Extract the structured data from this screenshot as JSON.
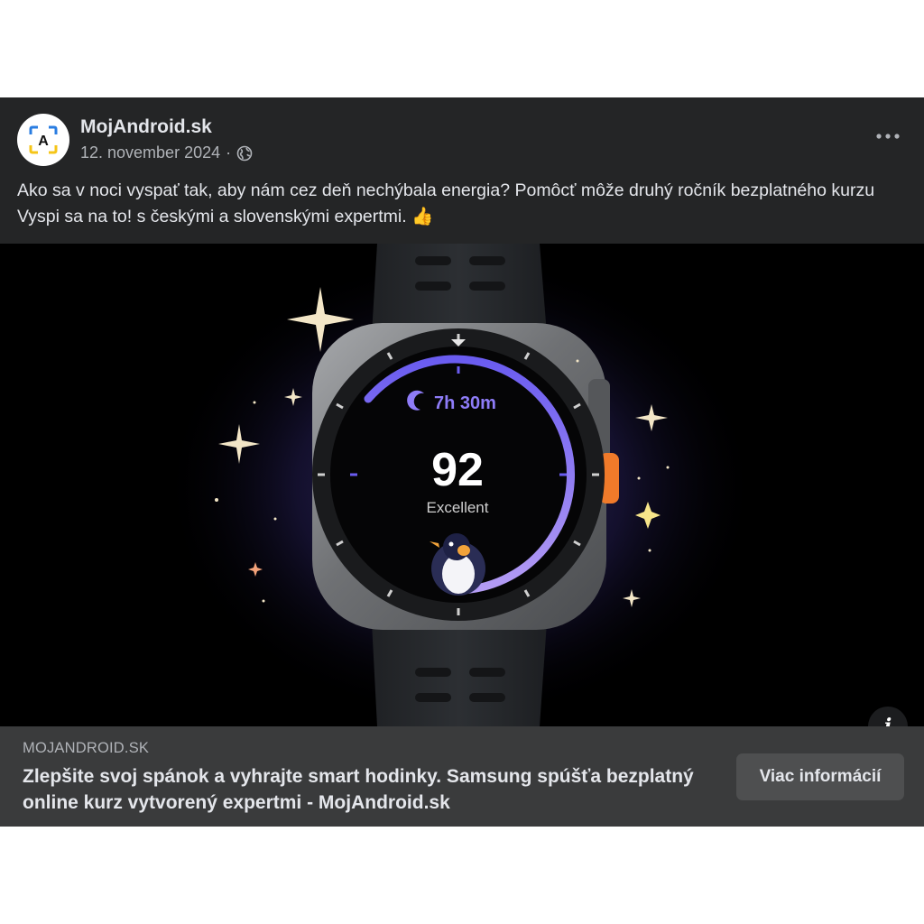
{
  "post": {
    "page_name": "MojAndroid.sk",
    "date": "12. november 2024",
    "separator": "·",
    "avatar_letter": "A",
    "text": "Ako sa v noci vyspať tak, aby nám cez deň nechýbala energia? Pomôcť môže druhý ročník bezplatného kurzu Vyspi sa na to! s českými a slovenskými expertmi. 👍"
  },
  "watch_face": {
    "duration": "7h 30m",
    "score": "92",
    "rating": "Excellent"
  },
  "link_preview": {
    "domain": "MOJANDROID.SK",
    "title": "Zlepšite svoj spánok a vyhrajte smart hodinky. Samsung spúšťa bezplatný online kurz vytvorený expertmi - MojAndroid.sk",
    "cta_label": "Viac informácií",
    "info_label": "i"
  },
  "icons": {
    "avatar": "logo-icon",
    "privacy": "globe-icon",
    "more": "more-options-icon",
    "info": "info-icon"
  },
  "colors": {
    "card_background": "#242526",
    "preview_background": "#3a3b3c",
    "button_background": "#4e4f50",
    "ring_accent": "#7b6cf6",
    "crown_accent": "#f07a2a"
  }
}
